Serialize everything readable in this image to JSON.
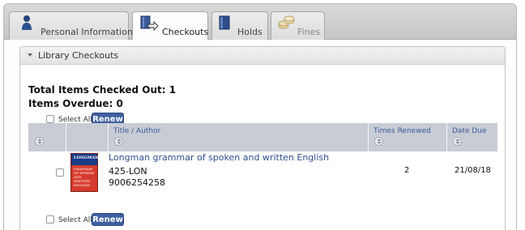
{
  "tabs": [
    {
      "label": "Personal Information",
      "icon": "person-icon"
    },
    {
      "label": "Checkouts",
      "icon": "book-arrow-icon"
    },
    {
      "label": "Holds",
      "icon": "book-icon"
    },
    {
      "label": "Fines",
      "icon": "coins-icon"
    }
  ],
  "active_tab": "Checkouts",
  "panel": {
    "title": "Library Checkouts"
  },
  "summary": {
    "total_checked_out": "Total Items Checked Out: 1",
    "overdue": "Items Overdue: 0"
  },
  "select_all_label": "Select All",
  "renew_label": "Renew",
  "table": {
    "headers": [
      "Title / Author",
      "Times Renewed",
      "Date Due"
    ],
    "rows": [
      {
        "title": "Longman grammar of spoken and written English",
        "call_number": "425-LON",
        "barcode": "9006254258",
        "times_renewed": "2",
        "date_due": "21/08/18",
        "cover": {
          "publisher": "LONGMAN",
          "text": "GRAMMAR OF SPOKEN AND WRITTEN ENGLISH"
        }
      }
    ]
  },
  "colors": {
    "accent": "#3f5fa0",
    "header_bg": "#c8ccd4",
    "link": "#2d4f8e"
  }
}
